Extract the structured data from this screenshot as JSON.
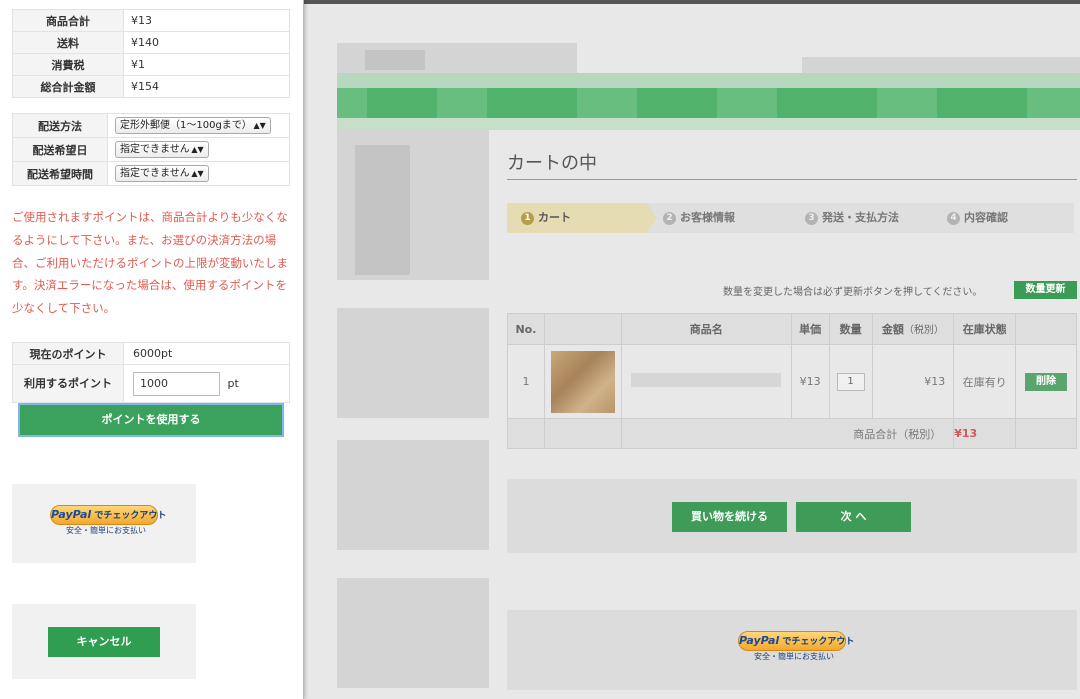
{
  "summary": {
    "rows": [
      {
        "label": "商品合計",
        "value": "¥13"
      },
      {
        "label": "送料",
        "value": "¥140"
      },
      {
        "label": "消費税",
        "value": "¥1"
      },
      {
        "label": "総合計金額",
        "value": "¥154"
      }
    ]
  },
  "shipping": {
    "method_label": "配送方法",
    "method_value": "定形外郵便（1〜100gまで）",
    "date_label": "配送希望日",
    "date_value": "指定できません",
    "time_label": "配送希望時間",
    "time_value": "指定できません"
  },
  "notice": "ご使用されますポイントは、商品合計よりも少なくなるようにして下さい。また、お選びの決済方法の場合、ご利用いただけるポイントの上限が変動いたします。決済エラーになった場合は、使用するポイントを少なくして下さい。",
  "points": {
    "current_label": "現在のポイント",
    "current_value": "6000pt",
    "use_label": "利用するポイント",
    "use_value": "1000",
    "unit": "pt",
    "use_button": "ポイントを使用する"
  },
  "paypal": {
    "brand": "PayPal",
    "checkout": "でチェックアウト",
    "sub": "安全・簡単にお支払い"
  },
  "cancel_button": "キャンセル",
  "cart": {
    "title": "カートの中",
    "steps": [
      {
        "num": "1",
        "label": "カート"
      },
      {
        "num": "2",
        "label": "お客様情報"
      },
      {
        "num": "3",
        "label": "発送・支払方法"
      },
      {
        "num": "4",
        "label": "内容確認"
      }
    ],
    "qty_note": "数量を変更した場合は必ず更新ボタンを押してください。",
    "qty_update": "数量更新",
    "headers": {
      "no": "No.",
      "name": "商品名",
      "unit_price": "単価",
      "qty": "数量",
      "amount": "金額",
      "amount_note": "（税別）",
      "stock": "在庫状態"
    },
    "item": {
      "no": "1",
      "unit_price": "¥13",
      "qty": "1",
      "amount": "¥13",
      "stock": "在庫有り",
      "delete": "削除"
    },
    "subtotal_label": "商品合計（税別）",
    "subtotal_value": "¥13",
    "continue_button": "買い物を続ける",
    "next_button": "次 へ"
  },
  "colors": {
    "accent_green": "#2f9e51",
    "notice_red": "#e05a4e",
    "paypal_gold": "#f4a72c"
  }
}
